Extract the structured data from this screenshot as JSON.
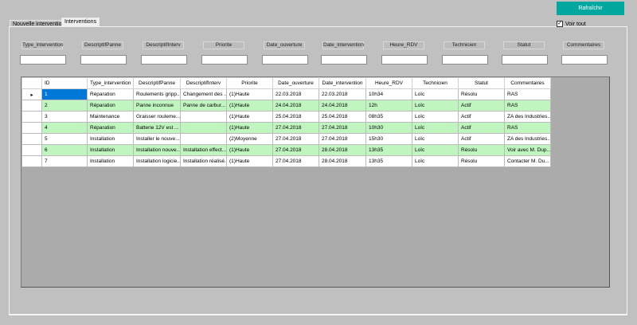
{
  "tabs": [
    {
      "label": "Nouvelle intervention",
      "active": false
    },
    {
      "label": "Interventions",
      "active": true
    }
  ],
  "refresh_button": "Rafraîchir",
  "show_all": {
    "label": "Voir tout",
    "checked": true
  },
  "accent_color": "#00a79f",
  "filters": [
    {
      "label": "Type_intervention",
      "value": ""
    },
    {
      "label": "DescriptifPanne",
      "value": ""
    },
    {
      "label": "DescriptifInterv",
      "value": ""
    },
    {
      "label": "Priorite",
      "value": ""
    },
    {
      "label": "Date_ouverture",
      "value": ""
    },
    {
      "label": "Date_intervention",
      "value": ""
    },
    {
      "label": "Heure_RDV",
      "value": ""
    },
    {
      "label": "Technicien",
      "value": ""
    },
    {
      "label": "Statut",
      "value": ""
    },
    {
      "label": "Commentaires",
      "value": ""
    }
  ],
  "grid": {
    "columns": [
      "ID",
      "Type_intervention",
      "DescriptifPanne",
      "DescriptifInterv",
      "Priorite",
      "Date_ouverture",
      "Date_intervention",
      "Heure_RDV",
      "Technicien",
      "Statut",
      "Commentaires"
    ],
    "rows": [
      [
        "1",
        "Réparation",
        "Roulements gripp...",
        "Changement des ...",
        "(1)Haute",
        "22.03.2018",
        "22.03.2018",
        "10h34",
        "Loïc",
        "Résolu",
        "RAS"
      ],
      [
        "2",
        "Réparation",
        "Panne inconnue",
        "Panne de carbur...",
        "(1)Haute",
        "24.04.2018",
        "24.04.2018",
        "12h",
        "Loïc",
        "Actif",
        "RAS"
      ],
      [
        "3",
        "Maintenance",
        "Graisser rouleme...",
        "",
        "(1)Haute",
        "25.04.2018",
        "25.04.2018",
        "08h35",
        "Loïc",
        "Actif",
        "ZA des Industries..."
      ],
      [
        "4",
        "Réparation",
        "Batterie 12V est ...",
        "",
        "(1)Haute",
        "27.04.2018",
        "27.04.2018",
        "10h30",
        "Loïc",
        "Actif",
        "RAS"
      ],
      [
        "5",
        "Installation",
        "Installer le nouve...",
        "",
        "(2)Moyenne",
        "27.04.2018",
        "27.04.2018",
        "15h30",
        "Loïc",
        "Actif",
        "ZA des Industries..."
      ],
      [
        "6",
        "Installation",
        "Installation nouve...",
        "Installation effect...",
        "(1)Haute",
        "27.04.2018",
        "28.04.2018",
        "13h35",
        "Loïc",
        "Résolu",
        "Voir avec M. Dup..."
      ],
      [
        "7",
        "Installation",
        "Installation logicie...",
        "Installation réalisé...",
        "(1)Haute",
        "27.04.2018",
        "28.04.2018",
        "13h35",
        "Loïc",
        "Résolu",
        "Contacter M. Du..."
      ]
    ],
    "selected_row": 0,
    "alt_row_color": "#c0f5c0"
  }
}
